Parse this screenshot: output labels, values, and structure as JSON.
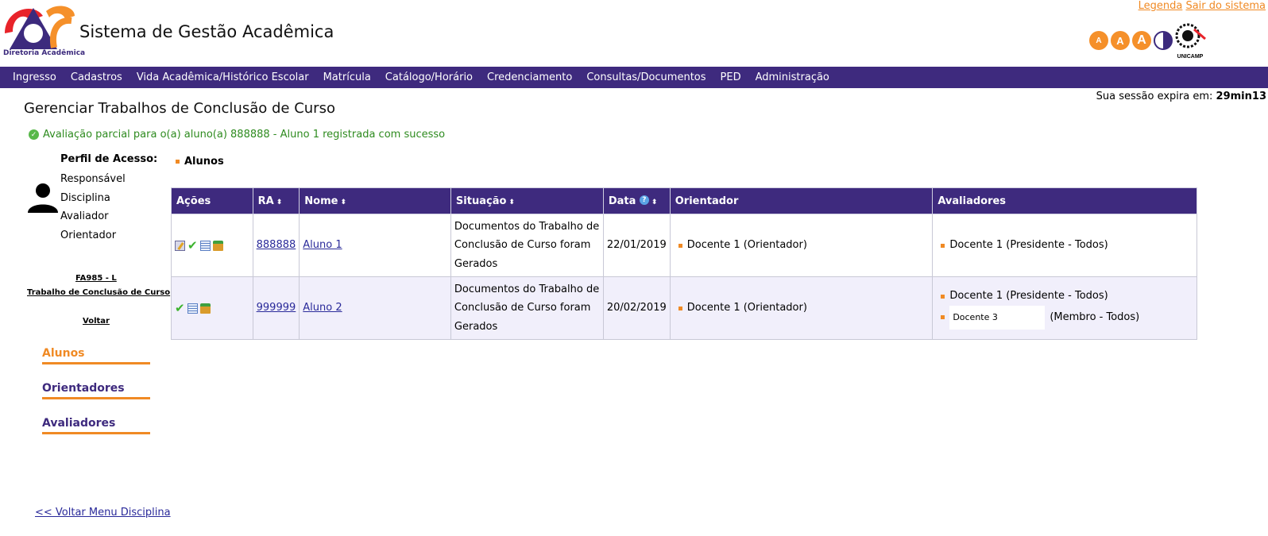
{
  "header": {
    "logo_caption": "Diretoria Acadêmica",
    "app_title": "Sistema de Gestão Acadêmica",
    "links": {
      "legend": "Legenda",
      "logout": "Sair do sistema"
    },
    "font_buttons": [
      "A",
      "A",
      "A"
    ],
    "university": "UNICAMP"
  },
  "menu": [
    "Ingresso",
    "Cadastros",
    "Vida Acadêmica/Histórico Escolar",
    "Matrícula",
    "Catálogo/Horário",
    "Credenciamento",
    "Consultas/Documentos",
    "PED",
    "Administração"
  ],
  "session": {
    "label": "Sua sessão expira em:",
    "time": "29min13"
  },
  "page": {
    "title": "Gerenciar Trabalhos de Conclusão de Curso",
    "success_message": "Avaliação parcial para o(a) aluno(a) 888888 - Aluno 1 registrada com sucesso"
  },
  "profile": {
    "heading": "Perfil de Acesso:",
    "roles": [
      "Responsável",
      "Disciplina",
      "Avaliador",
      "Orientador"
    ],
    "course_code": "FA985 - L",
    "course_name": "Trabalho de Conclusão de Curso",
    "back": "Voltar"
  },
  "sidenav": [
    "Alunos",
    "Orientadores",
    "Avaliadores"
  ],
  "back_menu": "<< Voltar Menu Disciplina",
  "section_label": "Alunos",
  "table": {
    "headers": {
      "actions": "Ações",
      "ra": "RA",
      "name": "Nome",
      "status": "Situação",
      "date": "Data",
      "advisor": "Orientador",
      "evaluators": "Avaliadores"
    },
    "rows": [
      {
        "ra": "888888",
        "name": "Aluno 1",
        "status": "Documentos do Trabalho de Conclusão de Curso foram Gerados",
        "date": "22/01/2019",
        "advisor": "Docente 1 (Orientador)",
        "evaluator1": "Docente 1 (Presidente - Todos)"
      },
      {
        "ra": "999999",
        "name": "Aluno 2",
        "status": "Documentos do Trabalho de Conclusão de Curso foram Gerados",
        "date": "20/02/2019",
        "advisor": "Docente 1 (Orientador)",
        "evaluator1": "Docente 1 (Presidente - Todos)",
        "evaluator2_name": "Docente 3",
        "evaluator2_role": "(Membro - Todos)"
      }
    ]
  },
  "colors": {
    "brand": "#3e2a7e",
    "accent": "#f08a24",
    "success": "#2e8b1f"
  }
}
